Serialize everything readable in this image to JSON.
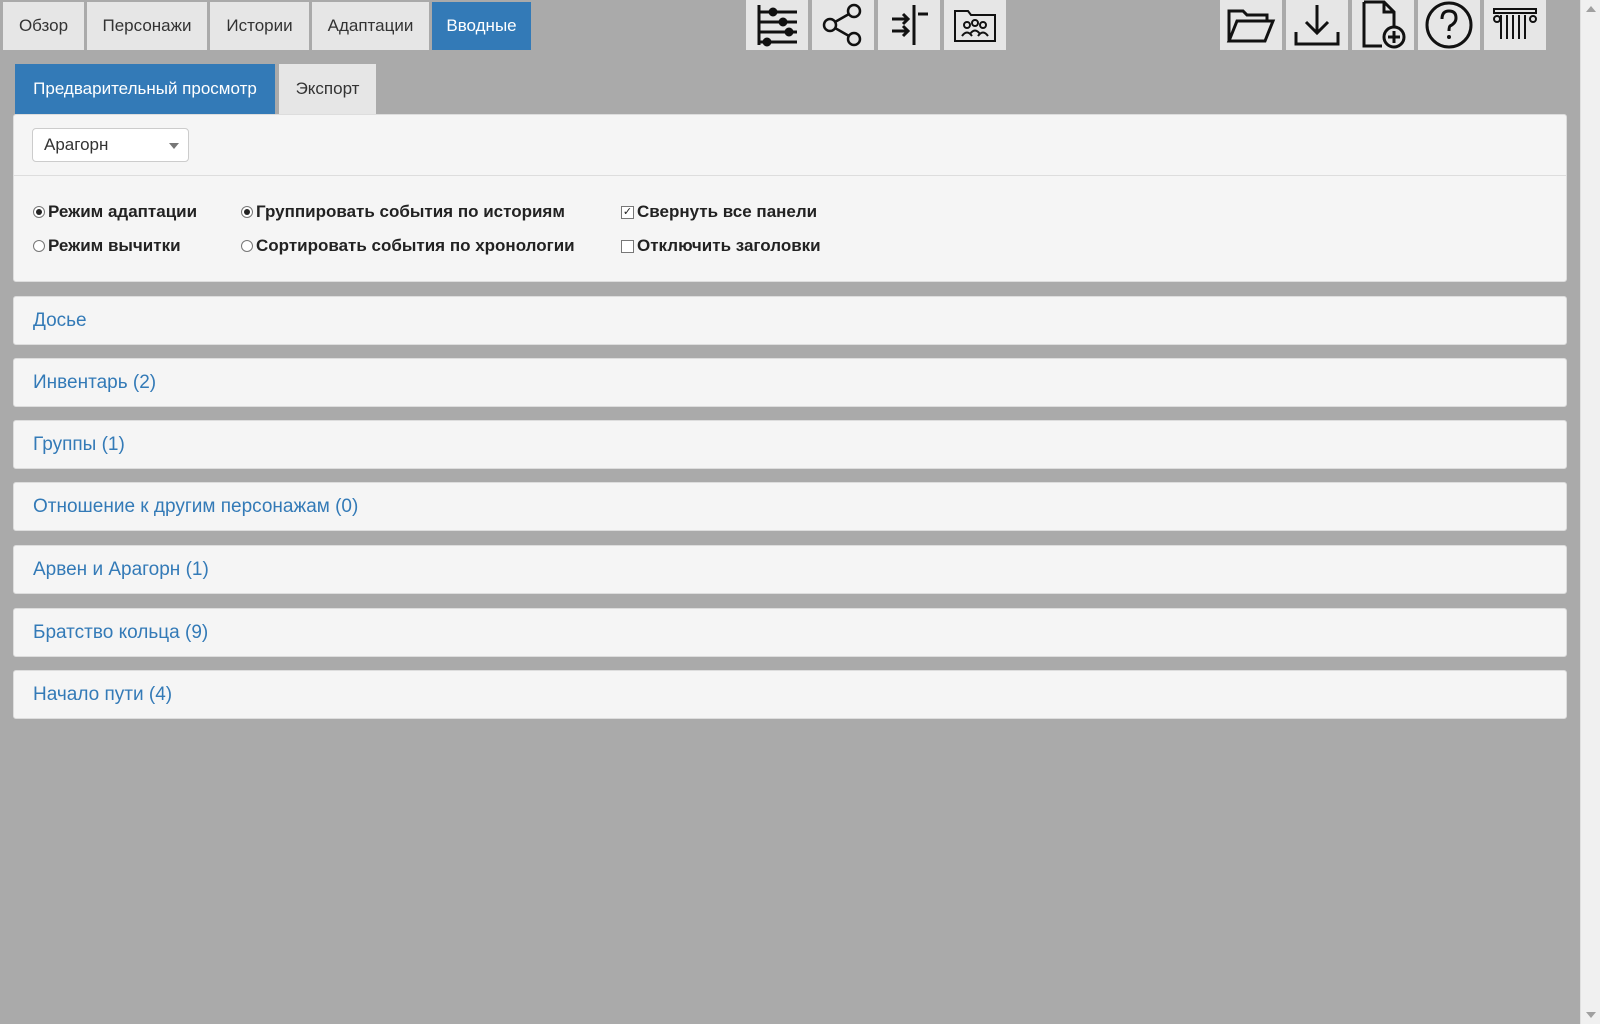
{
  "nav": {
    "tabs": [
      {
        "label": "Обзор",
        "active": false
      },
      {
        "label": "Персонажи",
        "active": false
      },
      {
        "label": "Истории",
        "active": false
      },
      {
        "label": "Адаптации",
        "active": false
      },
      {
        "label": "Вводные",
        "active": true
      }
    ]
  },
  "toolbar": {
    "center_icons": [
      "timeline-icon",
      "share-network-icon",
      "split-arrows-icon",
      "group-folder-icon"
    ],
    "right_icons": [
      "folder-open-icon",
      "download-icon",
      "new-document-icon",
      "help-icon",
      "columns-icon"
    ]
  },
  "subtabs": [
    {
      "label": "Предварительный просмотр",
      "active": true
    },
    {
      "label": "Экспорт",
      "active": false
    }
  ],
  "settings": {
    "character_select": "Арагорн",
    "mode_options": [
      {
        "label": "Режим адаптации",
        "checked": true
      },
      {
        "label": "Режим вычитки",
        "checked": false
      }
    ],
    "grouping_options": [
      {
        "label": "Группировать события по историям",
        "checked": true
      },
      {
        "label": "Сортировать события по хронологии",
        "checked": false
      }
    ],
    "checkboxes": [
      {
        "label": "Свернуть все панели",
        "checked": true
      },
      {
        "label": "Отключить заголовки",
        "checked": false
      }
    ]
  },
  "panels": [
    "Досье",
    "Инвентарь (2)",
    "Группы (1)",
    "Отношение к другим персонажам (0)",
    "Арвен и Арагорн (1)",
    "Братство кольца (9)",
    "Начало пути (4)"
  ],
  "colors": {
    "accent": "#337ab7",
    "background": "#aaaaaa",
    "panel": "#f5f5f5",
    "tab": "#e6e6e6"
  }
}
